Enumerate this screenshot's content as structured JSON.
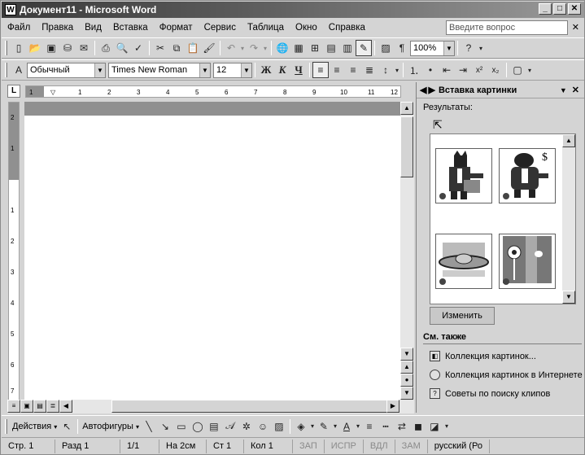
{
  "window": {
    "title": "Документ11 - Microsoft Word",
    "app_icon": "W"
  },
  "menu": [
    "Файл",
    "Правка",
    "Вид",
    "Вставка",
    "Формат",
    "Сервис",
    "Таблица",
    "Окно",
    "Справка"
  ],
  "ask_box": {
    "placeholder": "Введите вопрос"
  },
  "standard_toolbar": {
    "zoom": "100%"
  },
  "format_toolbar": {
    "style": "Обычный",
    "font": "Times New Roman",
    "size": "12",
    "bold": "Ж",
    "italic": "К",
    "underline": "Ч"
  },
  "ruler_marks": [
    "1",
    "2",
    "1",
    "2",
    "3",
    "4",
    "5",
    "6",
    "7",
    "8",
    "9",
    "10",
    "11",
    "12"
  ],
  "vruler_marks": [
    "2",
    "1",
    "1",
    "2",
    "3",
    "4",
    "5",
    "6",
    "7"
  ],
  "task_pane": {
    "title": "Вставка картинки",
    "results_label": "Результаты:",
    "change_button": "Изменить",
    "see_also": "См. также",
    "links": [
      "Коллекция картинок...",
      "Коллекция картинок в Интернете",
      "Советы по поиску клипов"
    ]
  },
  "drawing_toolbar": {
    "actions": "Действия",
    "autoshapes": "Автофигуры"
  },
  "statusbar": {
    "page": "Стр. 1",
    "section": "Разд 1",
    "pages": "1/1",
    "at": "На 2см",
    "line": "Ст 1",
    "col": "Кол 1",
    "rec": "ЗАП",
    "trk": "ИСПР",
    "ext": "ВДЛ",
    "ovr": "ЗАМ",
    "lang": "русский (Ро"
  }
}
